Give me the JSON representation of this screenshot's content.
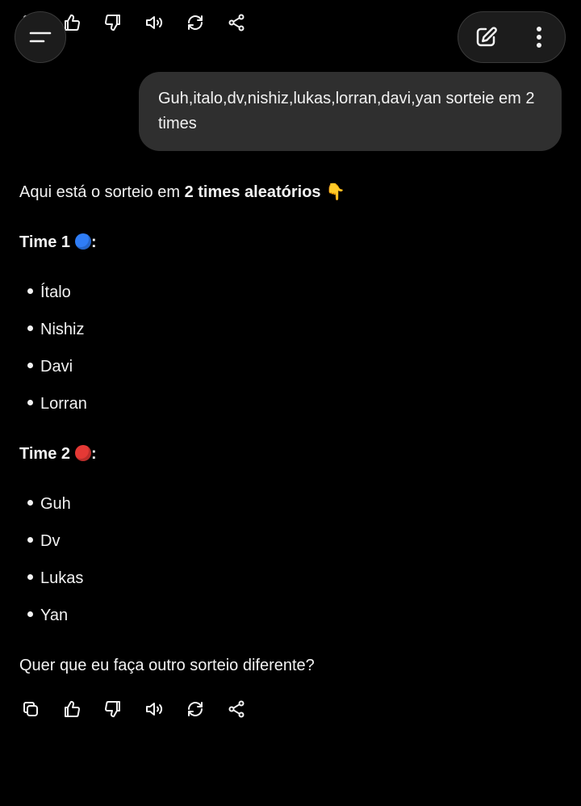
{
  "user_message": "Guh,italo,dv,nishiz,lukas,lorran,davi,yan sorteie em 2 times",
  "response": {
    "intro_prefix": "Aqui está o sorteio em ",
    "intro_bold": "2 times aleatórios",
    "intro_emoji": "👇",
    "team1_label": "Time 1",
    "team1_color": "#2f7df6",
    "team1_members": [
      "Ítalo",
      "Nishiz",
      "Davi",
      "Lorran"
    ],
    "team2_label": "Time 2",
    "team2_color": "#e53935",
    "team2_members": [
      "Guh",
      "Dv",
      "Lukas",
      "Yan"
    ],
    "closing": "Quer que eu faça outro sorteio diferente?",
    "colon": ":"
  },
  "icons": {
    "menu": "menu-icon",
    "new_chat": "edit-icon",
    "more": "more-vertical-icon",
    "copy": "copy-icon",
    "like": "thumbs-up-icon",
    "dislike": "thumbs-down-icon",
    "read_aloud": "speaker-icon",
    "regenerate": "refresh-icon",
    "share": "share-icon"
  }
}
